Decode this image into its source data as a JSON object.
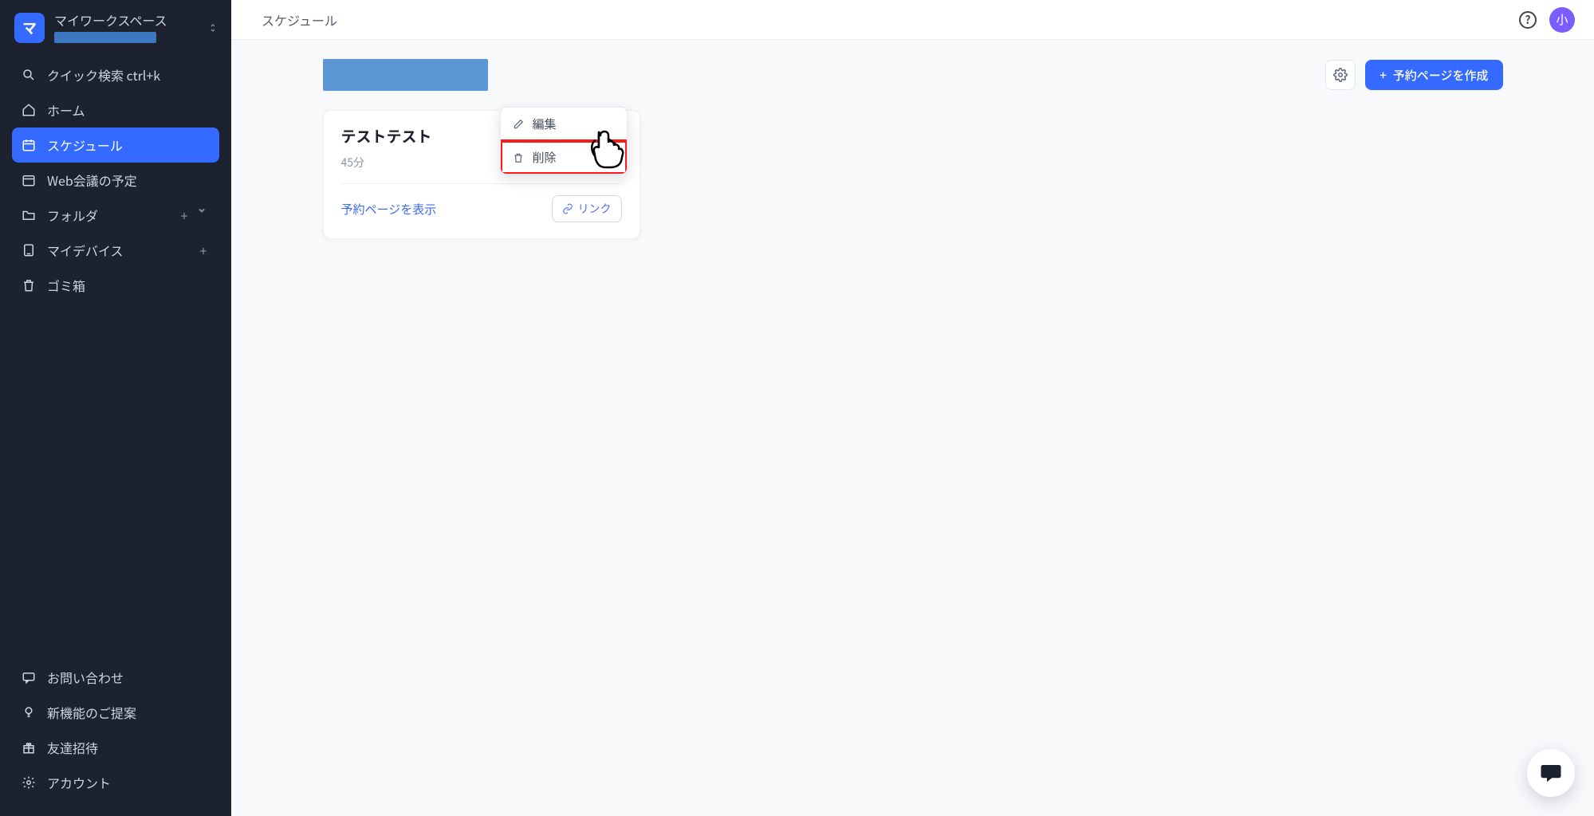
{
  "workspace": {
    "logo_initial": "マ",
    "title": "マイワークスペース"
  },
  "sidebar": {
    "items": [
      {
        "label": "クイック検索 ctrl+k"
      },
      {
        "label": "ホーム"
      },
      {
        "label": "スケジュール"
      },
      {
        "label": "Web会議の予定"
      },
      {
        "label": "フォルダ"
      },
      {
        "label": "マイデバイス"
      },
      {
        "label": "ゴミ箱"
      }
    ],
    "bottom": [
      {
        "label": "お問い合わせ"
      },
      {
        "label": "新機能のご提案"
      },
      {
        "label": "友達招待"
      },
      {
        "label": "アカウント"
      }
    ]
  },
  "topbar": {
    "title": "スケジュール",
    "avatar_initial": "小"
  },
  "buttons": {
    "create": "予約ページを作成"
  },
  "card": {
    "title": "テストテスト",
    "duration": "45分",
    "show_link": "予約ページを表示",
    "copy_label": "リンク"
  },
  "menu": {
    "edit": "編集",
    "delete": "削除"
  }
}
